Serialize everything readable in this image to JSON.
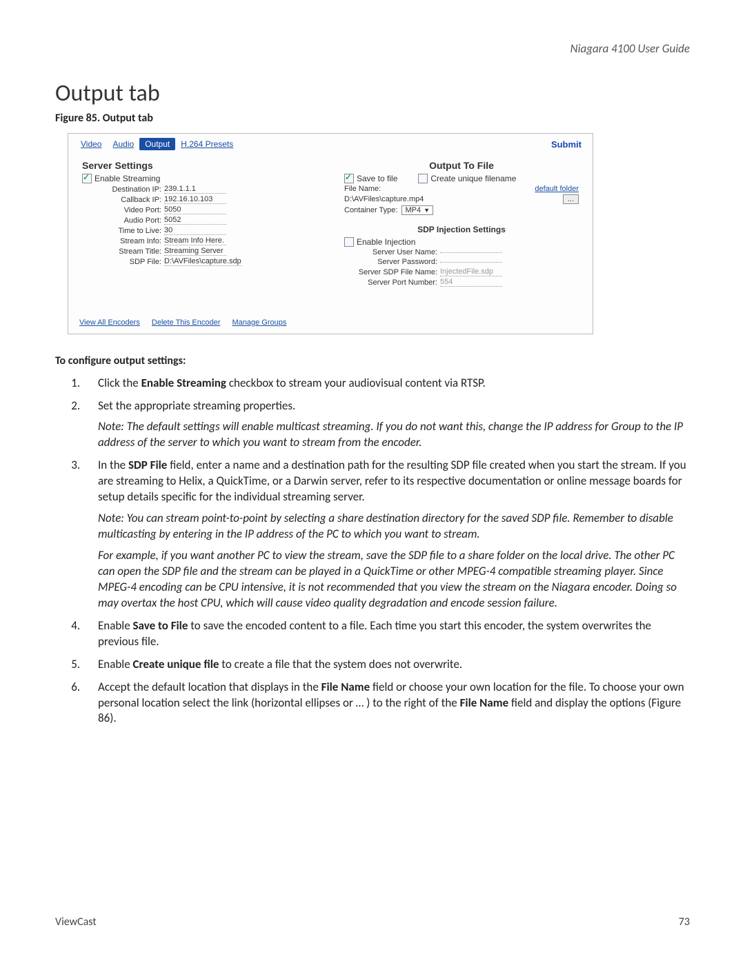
{
  "header": {
    "guide": "Niagara 4100 User Guide"
  },
  "title": "Output tab",
  "figure_caption": "Figure 85. Output tab",
  "shot": {
    "tabs": {
      "video": "Video",
      "audio": "Audio",
      "output": "Output",
      "presets": "H.264 Presets"
    },
    "submit": "Submit",
    "server": {
      "heading": "Server Settings",
      "enable_streaming_label": "Enable Streaming",
      "dest_ip_label": "Destination IP:",
      "dest_ip": "239.1.1.1",
      "callback_ip_label": "Callback IP:",
      "callback_ip": "192.16.10.103",
      "video_port_label": "Video Port:",
      "video_port": "5050",
      "audio_port_label": "Audio Port:",
      "audio_port": "5052",
      "ttl_label": "Time to Live:",
      "ttl": "30",
      "stream_info_label": "Stream Info:",
      "stream_info": "Stream Info Here.",
      "stream_title_label": "Stream Title:",
      "stream_title": "Streaming Server",
      "sdp_file_label": "SDP File:",
      "sdp_file": "D:\\AVFiles\\capture.sdp"
    },
    "outputfile": {
      "heading": "Output To File",
      "save_to_file_label": "Save to file",
      "unique_label": "Create unique filename",
      "filename_label": "File Name:",
      "default_folder": "default folder",
      "filename_value": "D:\\AVFiles\\capture.mp4",
      "browse": "...",
      "container_label": "Container Type:",
      "container_value": "MP4"
    },
    "sdp": {
      "heading": "SDP Injection Settings",
      "enable_label": "Enable Injection",
      "user_label": "Server User Name:",
      "pass_label": "Server Password:",
      "sdp_name_label": "Server SDP File Name:",
      "sdp_name_value": "InjectedFile.sdp",
      "port_label": "Server Port Number:",
      "port_value": "554"
    },
    "footer_links": {
      "view": "View All Encoders",
      "del": "Delete This Encoder",
      "manage": "Manage Groups"
    }
  },
  "body": {
    "lead": "To configure output settings:",
    "steps": {
      "s1a": "Click the ",
      "s1b": "Enable Streaming",
      "s1c": " checkbox to stream your audiovisual content via RTSP.",
      "s2": "Set the appropriate streaming properties.",
      "s2note": "Note: The default settings will enable multicast streaming. If you do not want this, change the IP address for Group to the IP address of the server to which you want to stream from the encoder.",
      "s3a": "In the ",
      "s3b": "SDP File",
      "s3c": " field, enter a name and a destination path for the resulting SDP file created when you start the stream. If you are streaming to Helix, a QuickTime, or a Darwin server, refer to its respective documentation or online message boards for setup details specific for the individual streaming server.",
      "s3note1": "Note: You can stream point-to-point by selecting a share destination directory for the saved SDP file. Remember to disable multicasting by entering in the IP address of the PC to which you want to stream.",
      "s3note2": "For example, if you want another PC to view the stream, save the SDP file to a share folder on the local drive. The other PC can open the SDP file and the stream can be played in a QuickTime or other MPEG-4 compatible streaming player. Since MPEG-4 encoding can be CPU intensive, it is not recommended that you view the stream on the Niagara encoder. Doing so may overtax the host CPU, which will cause video quality degradation and encode session failure.",
      "s4a": "Enable ",
      "s4b": "Save to File",
      "s4c": " to save the encoded content to a file. Each time you start this encoder, the system overwrites the previous file.",
      "s5a": "Enable ",
      "s5b": "Create unique file",
      "s5c": " to create a file that the system does not overwrite.",
      "s6a": "Accept the default location that displays in the ",
      "s6b": "File Name",
      "s6c": " field or choose your own location for the file. To choose your own personal location select the link (horizontal ellipses or … ) to the right of the ",
      "s6d": "File Name",
      "s6e": " field and display the options (Figure 86)."
    }
  },
  "footer": {
    "brand": "ViewCast",
    "page": "73"
  }
}
